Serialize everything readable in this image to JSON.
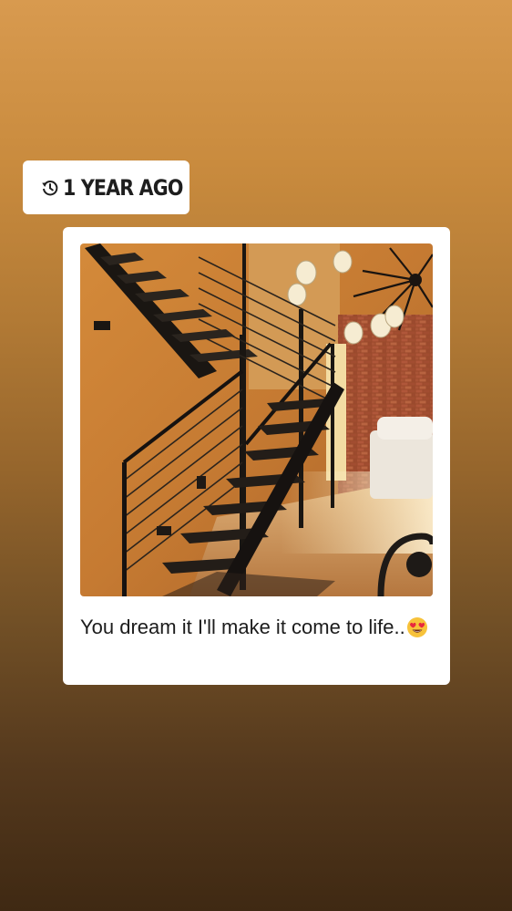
{
  "memory": {
    "icon": "history-clock-icon",
    "label": "1 YEAR AGO"
  },
  "post": {
    "caption_text": "You dream it I'll make it come to life..",
    "caption_emoji": "heart-eyes-emoji-icon",
    "image_subject": "photo-icon"
  },
  "colors": {
    "background_top": "#d89a4f",
    "background_bottom": "#3f2913",
    "card": "#ffffff",
    "text": "#1c1c1c"
  }
}
